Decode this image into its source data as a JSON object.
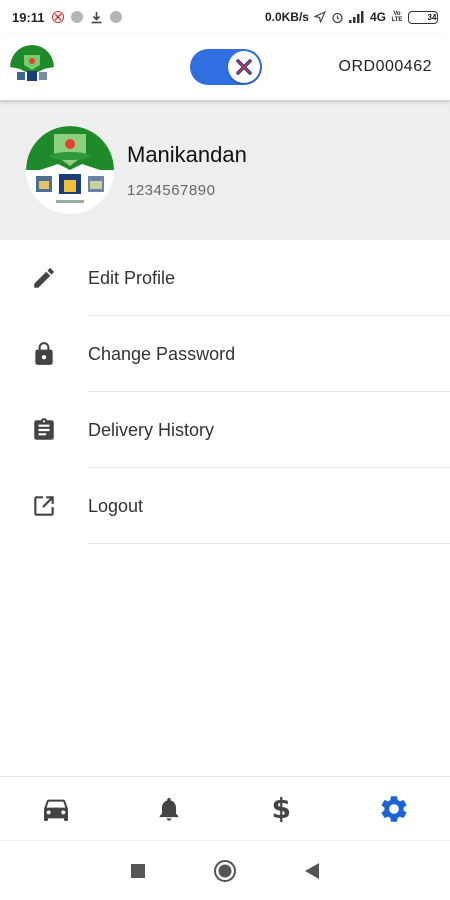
{
  "status_bar": {
    "time": "19:11",
    "network_speed": "0.0KB/s",
    "signal": "4G",
    "volte": "Vo LTE",
    "battery": "34"
  },
  "app_bar": {
    "order_id": "ORD000462",
    "toggle_state": "on",
    "accent_color": "#2f6fe0"
  },
  "profile": {
    "name": "Manikandan",
    "phone": "1234567890"
  },
  "menu": {
    "items": [
      {
        "label": "Edit Profile",
        "icon": "pencil-icon"
      },
      {
        "label": "Change Password",
        "icon": "lock-icon"
      },
      {
        "label": "Delivery History",
        "icon": "clipboard-icon"
      },
      {
        "label": "Logout",
        "icon": "share-icon"
      }
    ]
  },
  "bottom_nav": {
    "items": [
      {
        "icon": "car-icon",
        "active": false
      },
      {
        "icon": "bell-icon",
        "active": false
      },
      {
        "icon": "dollar-icon",
        "symbol": "$",
        "active": false
      },
      {
        "icon": "gear-icon",
        "active": true
      }
    ],
    "active_color": "#1e63d6",
    "inactive_color": "#444444"
  },
  "system_nav": {
    "items": [
      "recents-button",
      "home-button",
      "back-button"
    ]
  }
}
